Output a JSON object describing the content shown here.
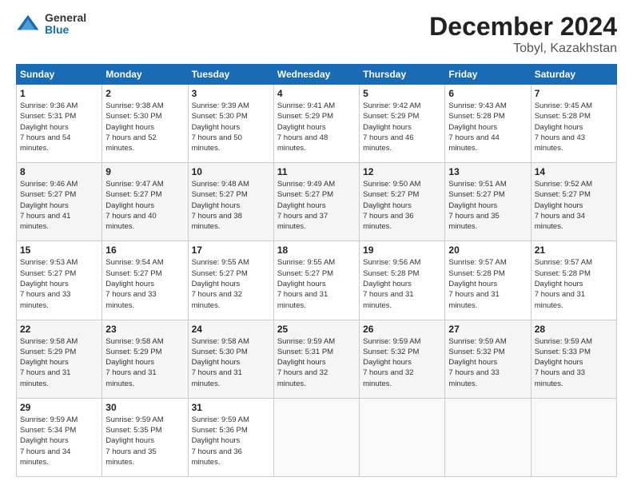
{
  "header": {
    "logo_general": "General",
    "logo_blue": "Blue",
    "month_title": "December 2024",
    "location": "Tobyl, Kazakhstan"
  },
  "weekdays": [
    "Sunday",
    "Monday",
    "Tuesday",
    "Wednesday",
    "Thursday",
    "Friday",
    "Saturday"
  ],
  "weeks": [
    [
      {
        "day": "1",
        "sunrise": "9:36 AM",
        "sunset": "5:31 PM",
        "daylight": "7 hours and 54 minutes."
      },
      {
        "day": "2",
        "sunrise": "9:38 AM",
        "sunset": "5:30 PM",
        "daylight": "7 hours and 52 minutes."
      },
      {
        "day": "3",
        "sunrise": "9:39 AM",
        "sunset": "5:30 PM",
        "daylight": "7 hours and 50 minutes."
      },
      {
        "day": "4",
        "sunrise": "9:41 AM",
        "sunset": "5:29 PM",
        "daylight": "7 hours and 48 minutes."
      },
      {
        "day": "5",
        "sunrise": "9:42 AM",
        "sunset": "5:29 PM",
        "daylight": "7 hours and 46 minutes."
      },
      {
        "day": "6",
        "sunrise": "9:43 AM",
        "sunset": "5:28 PM",
        "daylight": "7 hours and 44 minutes."
      },
      {
        "day": "7",
        "sunrise": "9:45 AM",
        "sunset": "5:28 PM",
        "daylight": "7 hours and 43 minutes."
      }
    ],
    [
      {
        "day": "8",
        "sunrise": "9:46 AM",
        "sunset": "5:27 PM",
        "daylight": "7 hours and 41 minutes."
      },
      {
        "day": "9",
        "sunrise": "9:47 AM",
        "sunset": "5:27 PM",
        "daylight": "7 hours and 40 minutes."
      },
      {
        "day": "10",
        "sunrise": "9:48 AM",
        "sunset": "5:27 PM",
        "daylight": "7 hours and 38 minutes."
      },
      {
        "day": "11",
        "sunrise": "9:49 AM",
        "sunset": "5:27 PM",
        "daylight": "7 hours and 37 minutes."
      },
      {
        "day": "12",
        "sunrise": "9:50 AM",
        "sunset": "5:27 PM",
        "daylight": "7 hours and 36 minutes."
      },
      {
        "day": "13",
        "sunrise": "9:51 AM",
        "sunset": "5:27 PM",
        "daylight": "7 hours and 35 minutes."
      },
      {
        "day": "14",
        "sunrise": "9:52 AM",
        "sunset": "5:27 PM",
        "daylight": "7 hours and 34 minutes."
      }
    ],
    [
      {
        "day": "15",
        "sunrise": "9:53 AM",
        "sunset": "5:27 PM",
        "daylight": "7 hours and 33 minutes."
      },
      {
        "day": "16",
        "sunrise": "9:54 AM",
        "sunset": "5:27 PM",
        "daylight": "7 hours and 33 minutes."
      },
      {
        "day": "17",
        "sunrise": "9:55 AM",
        "sunset": "5:27 PM",
        "daylight": "7 hours and 32 minutes."
      },
      {
        "day": "18",
        "sunrise": "9:55 AM",
        "sunset": "5:27 PM",
        "daylight": "7 hours and 31 minutes."
      },
      {
        "day": "19",
        "sunrise": "9:56 AM",
        "sunset": "5:28 PM",
        "daylight": "7 hours and 31 minutes."
      },
      {
        "day": "20",
        "sunrise": "9:57 AM",
        "sunset": "5:28 PM",
        "daylight": "7 hours and 31 minutes."
      },
      {
        "day": "21",
        "sunrise": "9:57 AM",
        "sunset": "5:28 PM",
        "daylight": "7 hours and 31 minutes."
      }
    ],
    [
      {
        "day": "22",
        "sunrise": "9:58 AM",
        "sunset": "5:29 PM",
        "daylight": "7 hours and 31 minutes."
      },
      {
        "day": "23",
        "sunrise": "9:58 AM",
        "sunset": "5:29 PM",
        "daylight": "7 hours and 31 minutes."
      },
      {
        "day": "24",
        "sunrise": "9:58 AM",
        "sunset": "5:30 PM",
        "daylight": "7 hours and 31 minutes."
      },
      {
        "day": "25",
        "sunrise": "9:59 AM",
        "sunset": "5:31 PM",
        "daylight": "7 hours and 32 minutes."
      },
      {
        "day": "26",
        "sunrise": "9:59 AM",
        "sunset": "5:32 PM",
        "daylight": "7 hours and 32 minutes."
      },
      {
        "day": "27",
        "sunrise": "9:59 AM",
        "sunset": "5:32 PM",
        "daylight": "7 hours and 33 minutes."
      },
      {
        "day": "28",
        "sunrise": "9:59 AM",
        "sunset": "5:33 PM",
        "daylight": "7 hours and 33 minutes."
      }
    ],
    [
      {
        "day": "29",
        "sunrise": "9:59 AM",
        "sunset": "5:34 PM",
        "daylight": "7 hours and 34 minutes."
      },
      {
        "day": "30",
        "sunrise": "9:59 AM",
        "sunset": "5:35 PM",
        "daylight": "7 hours and 35 minutes."
      },
      {
        "day": "31",
        "sunrise": "9:59 AM",
        "sunset": "5:36 PM",
        "daylight": "7 hours and 36 minutes."
      },
      null,
      null,
      null,
      null
    ]
  ]
}
